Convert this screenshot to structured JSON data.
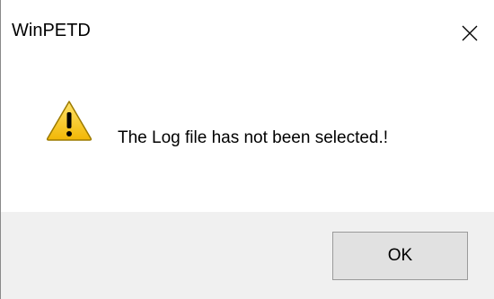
{
  "window": {
    "title": "WinPETD"
  },
  "icons": {
    "close": "close-icon",
    "warning": "warning-icon"
  },
  "message": {
    "text": "The Log file has not been selected.!"
  },
  "buttons": {
    "ok_label": "OK"
  },
  "colors": {
    "background": "#ffffff",
    "button_bar": "#f0f0f0",
    "button_face": "#e1e1e1",
    "button_border": "#9a9a9a",
    "warning_fill": "#f5c518",
    "warning_outline": "#8a6d00"
  }
}
